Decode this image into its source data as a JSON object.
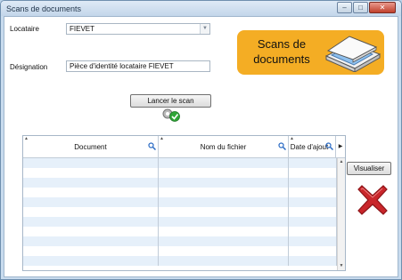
{
  "window": {
    "title": "Scans de documents"
  },
  "form": {
    "tenant_label": "Locataire",
    "tenant_value": "FIEVET",
    "designation_label": "Désignation",
    "designation_value": "Pièce d'identité locataire FIEVET"
  },
  "banner": {
    "text": "Scans de documents",
    "color": "#f4ad24",
    "icon": "scanner-icon"
  },
  "buttons": {
    "scan_label": "Lancer le scan",
    "view_label": "Visualiser",
    "delete_icon": "red-x-icon"
  },
  "grid": {
    "columns": [
      "Document",
      "Nom du fichier",
      "Date d'ajout"
    ],
    "rows": [
      [
        "",
        "",
        ""
      ],
      [
        "",
        "",
        ""
      ],
      [
        "",
        "",
        ""
      ],
      [
        "",
        "",
        ""
      ],
      [
        "",
        "",
        ""
      ],
      [
        "",
        "",
        ""
      ],
      [
        "",
        "",
        ""
      ],
      [
        "",
        "",
        ""
      ],
      [
        "",
        "",
        ""
      ],
      [
        "",
        "",
        ""
      ],
      [
        "",
        "",
        ""
      ]
    ]
  },
  "colors": {
    "row_alt": "#e6f0fa",
    "banner": "#f4ad24",
    "delete": "#c9262b"
  }
}
